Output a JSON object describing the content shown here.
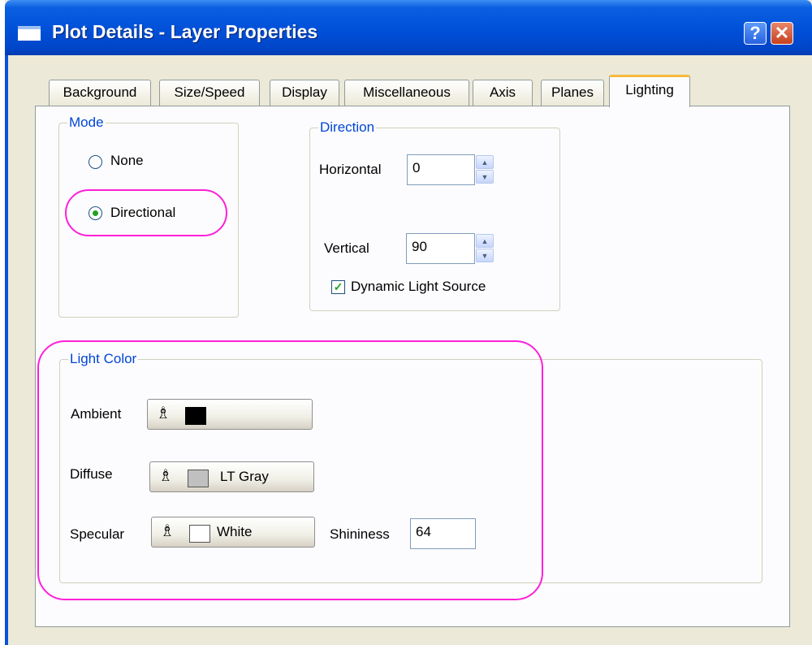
{
  "window": {
    "title": "Plot Details - Layer Properties",
    "help_label": "?",
    "close_label": "✕"
  },
  "tabs": [
    {
      "label": "Background"
    },
    {
      "label": "Size/Speed"
    },
    {
      "label": "Display"
    },
    {
      "label": "Miscellaneous"
    },
    {
      "label": "Axis"
    },
    {
      "label": "Planes"
    },
    {
      "label": "Lighting",
      "active": true
    }
  ],
  "mode": {
    "legend": "Mode",
    "options": [
      {
        "label": "None",
        "selected": false
      },
      {
        "label": "Directional",
        "selected": true
      }
    ]
  },
  "direction": {
    "legend": "Direction",
    "horizontal_label": "Horizontal",
    "horizontal_value": "0",
    "vertical_label": "Vertical",
    "vertical_value": "90",
    "dynamic_label": "Dynamic Light Source",
    "dynamic_checked": true
  },
  "light_color": {
    "legend": "Light Color",
    "ambient_label": "Ambient",
    "ambient_color_name": "",
    "ambient_color": "#000000",
    "diffuse_label": "Diffuse",
    "diffuse_color_name": "LT Gray",
    "diffuse_color": "#c0c0c0",
    "specular_label": "Specular",
    "specular_color_name": "White",
    "specular_color": "#ffffff",
    "shininess_label": "Shininess",
    "shininess_value": "64"
  },
  "colors": {
    "highlight": "#ff1fd8",
    "group_legend": "#0046d5",
    "active_tab_accent": "#f7b93c"
  },
  "icons": {
    "fill_bucket": "paint-bucket-icon",
    "spin_up": "chevron-up-icon",
    "spin_down": "chevron-down-icon"
  }
}
